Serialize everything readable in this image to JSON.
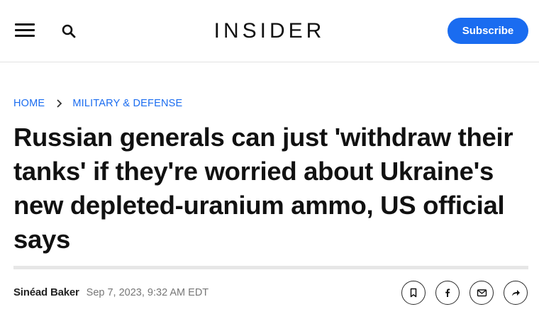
{
  "header": {
    "menu_icon": "hamburger-menu-icon",
    "search_icon": "search-icon",
    "logo": "INSIDER",
    "subscribe_label": "Subscribe",
    "accent_color": "#1a6cf0"
  },
  "breadcrumb": {
    "items": [
      {
        "label": "HOME"
      },
      {
        "label": "MILITARY & DEFENSE"
      }
    ],
    "separator_icon": "chevron-right-icon"
  },
  "article": {
    "headline": "Russian generals can just 'withdraw their tanks' if they're worried about Ukraine's new depleted-uranium ammo, US official says",
    "author": "Sinéad Baker",
    "date": "Sep 7, 2023, 9:32 AM EDT"
  },
  "share_buttons": [
    {
      "icon": "bookmark-icon"
    },
    {
      "icon": "facebook-icon"
    },
    {
      "icon": "email-icon"
    },
    {
      "icon": "share-arrow-icon"
    }
  ]
}
